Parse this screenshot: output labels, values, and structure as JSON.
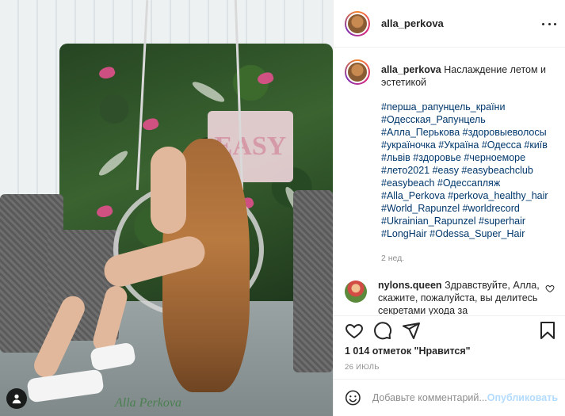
{
  "post": {
    "username": "alla_perkova",
    "image_signature": "Alla Perkova",
    "caption": "Наслаждение летом и эстетикой",
    "hashtag_lines": [
      "#перша_рапунцель_країни",
      "#Одесская_Рапунцель",
      "#Алла_Перькова #здоровыеволосы",
      "#україночка #Україна #Одесса #київ",
      "#львів #здоровье #черноеморе",
      "#лето2021 #easy #easybeachclub",
      "#easybeach #Одессапляж",
      "#Alla_Perkova #perkova_healthy_hair",
      "#World_Rapunzel #worldrecord",
      "#Ukrainian_Rapunzel #superhair",
      "#LongHair #Odessa_Super_Hair"
    ],
    "time_ago": "2 нед.",
    "likes": "1 014 отметок \"Нравится\"",
    "date": "26 ИЮЛЬ"
  },
  "comment": {
    "username": "nylons.queen",
    "text": "Здравствуйте, Алла, скажите, пожалуйста, вы делитесь секретами ухода за"
  },
  "add_comment": {
    "placeholder": "Добавьте комментарий...",
    "post_label": "Опубликовать"
  },
  "icons": {
    "more": "more-horizontal-icon",
    "like": "heart-icon",
    "comment": "comment-bubble-icon",
    "share": "paper-plane-icon",
    "save": "bookmark-icon",
    "emoji": "smiley-icon",
    "tagged": "user-icon"
  },
  "colors": {
    "hashtag": "#00376b",
    "muted": "#8e8e8e",
    "post_button": "#b3dbff"
  }
}
